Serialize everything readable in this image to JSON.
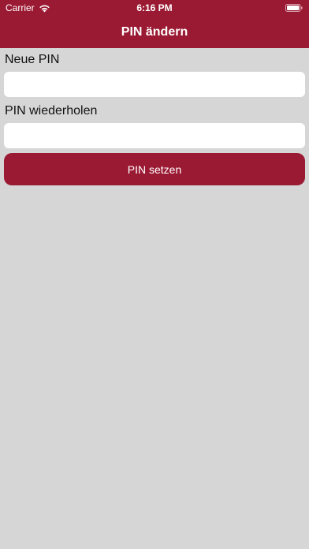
{
  "status_bar": {
    "carrier": "Carrier",
    "time": "6:16 PM",
    "wifi_icon": "wifi-icon",
    "battery_icon": "battery-icon"
  },
  "nav": {
    "title": "PIN ändern"
  },
  "form": {
    "new_pin": {
      "label": "Neue PIN",
      "value": "",
      "placeholder": ""
    },
    "repeat_pin": {
      "label": "PIN wiederholen",
      "value": "",
      "placeholder": ""
    },
    "submit_label": "PIN setzen"
  },
  "colors": {
    "accent": "#9b1a33",
    "background": "#d6d6d6",
    "field_background": "#ffffff"
  }
}
